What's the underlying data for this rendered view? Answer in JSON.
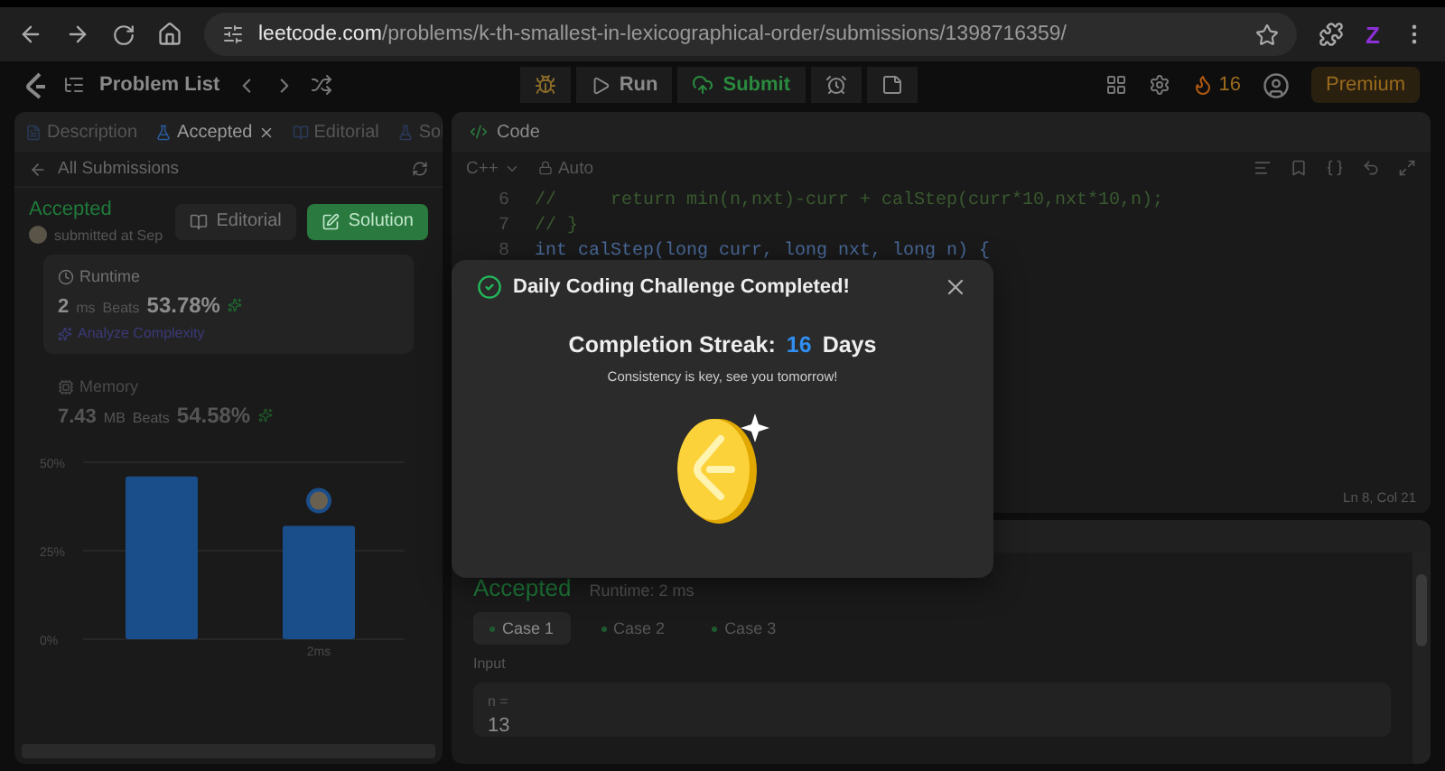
{
  "browser": {
    "url_domain": "leetcode.com",
    "url_path": "/problems/k-th-smallest-in-lexicographical-order/submissions/1398716359/",
    "profile_letter": "Z"
  },
  "topbar": {
    "problem_list": "Problem List",
    "run": "Run",
    "submit": "Submit",
    "streak": "16",
    "premium": "Premium"
  },
  "left_panel": {
    "tabs": [
      {
        "label": "Description",
        "selected": false,
        "closable": false
      },
      {
        "label": "Accepted",
        "selected": true,
        "closable": true
      },
      {
        "label": "Editorial",
        "selected": false,
        "closable": false
      },
      {
        "label": "Sol",
        "selected": false,
        "closable": false
      }
    ],
    "back_label": "All Submissions",
    "status": "Accepted",
    "submitted": "submitted at Sep",
    "buttons": [
      {
        "label": "Editorial",
        "kind": "plain"
      },
      {
        "label": "Solution",
        "kind": "primary"
      }
    ],
    "runtime": {
      "title": "Runtime",
      "value": "2",
      "unit": "ms",
      "beats_label": "Beats",
      "beats": "53.78%",
      "link": "Analyze Complexity"
    },
    "memory": {
      "title": "Memory",
      "value": "7.43",
      "unit": "MB",
      "beats_label": "Beats",
      "beats": "54.58%"
    },
    "chart_data": {
      "type": "bar",
      "categories": [
        null,
        "2ms"
      ],
      "values": [
        46,
        32
      ],
      "ylim": [
        0,
        50
      ],
      "yticks": [
        {
          "value": 0,
          "label": "0%"
        },
        {
          "value": 25,
          "label": "25%"
        },
        {
          "value": 50,
          "label": "50%"
        }
      ]
    }
  },
  "code_panel": {
    "title": "Code",
    "language": "C++",
    "mode": "Auto",
    "lines": [
      {
        "number": "6",
        "text": "//     return min(n,nxt)-curr + calStep(curr*10,nxt*10,n);",
        "kind": "comment"
      },
      {
        "number": "7",
        "text": "// }",
        "kind": "comment"
      },
      {
        "number": "8",
        "text": "int calStep(long curr, long nxt, long n) {",
        "kind": "code"
      }
    ],
    "cursor": "Ln 8, Col 21"
  },
  "result_panel": {
    "status": "Accepted",
    "runtime": "Runtime: 2 ms",
    "cases": [
      {
        "label": "Case 1",
        "selected": true
      },
      {
        "label": "Case 2",
        "selected": false
      },
      {
        "label": "Case 3",
        "selected": false
      }
    ],
    "input_label": "Input",
    "input_name": "n =",
    "input_value": "13"
  },
  "dialog": {
    "title": "Daily Coding Challenge Completed!",
    "streak_label": "Completion Streak:",
    "streak_value": "16",
    "streak_unit": "Days",
    "message": "Consistency is key, see you tomorrow!"
  }
}
